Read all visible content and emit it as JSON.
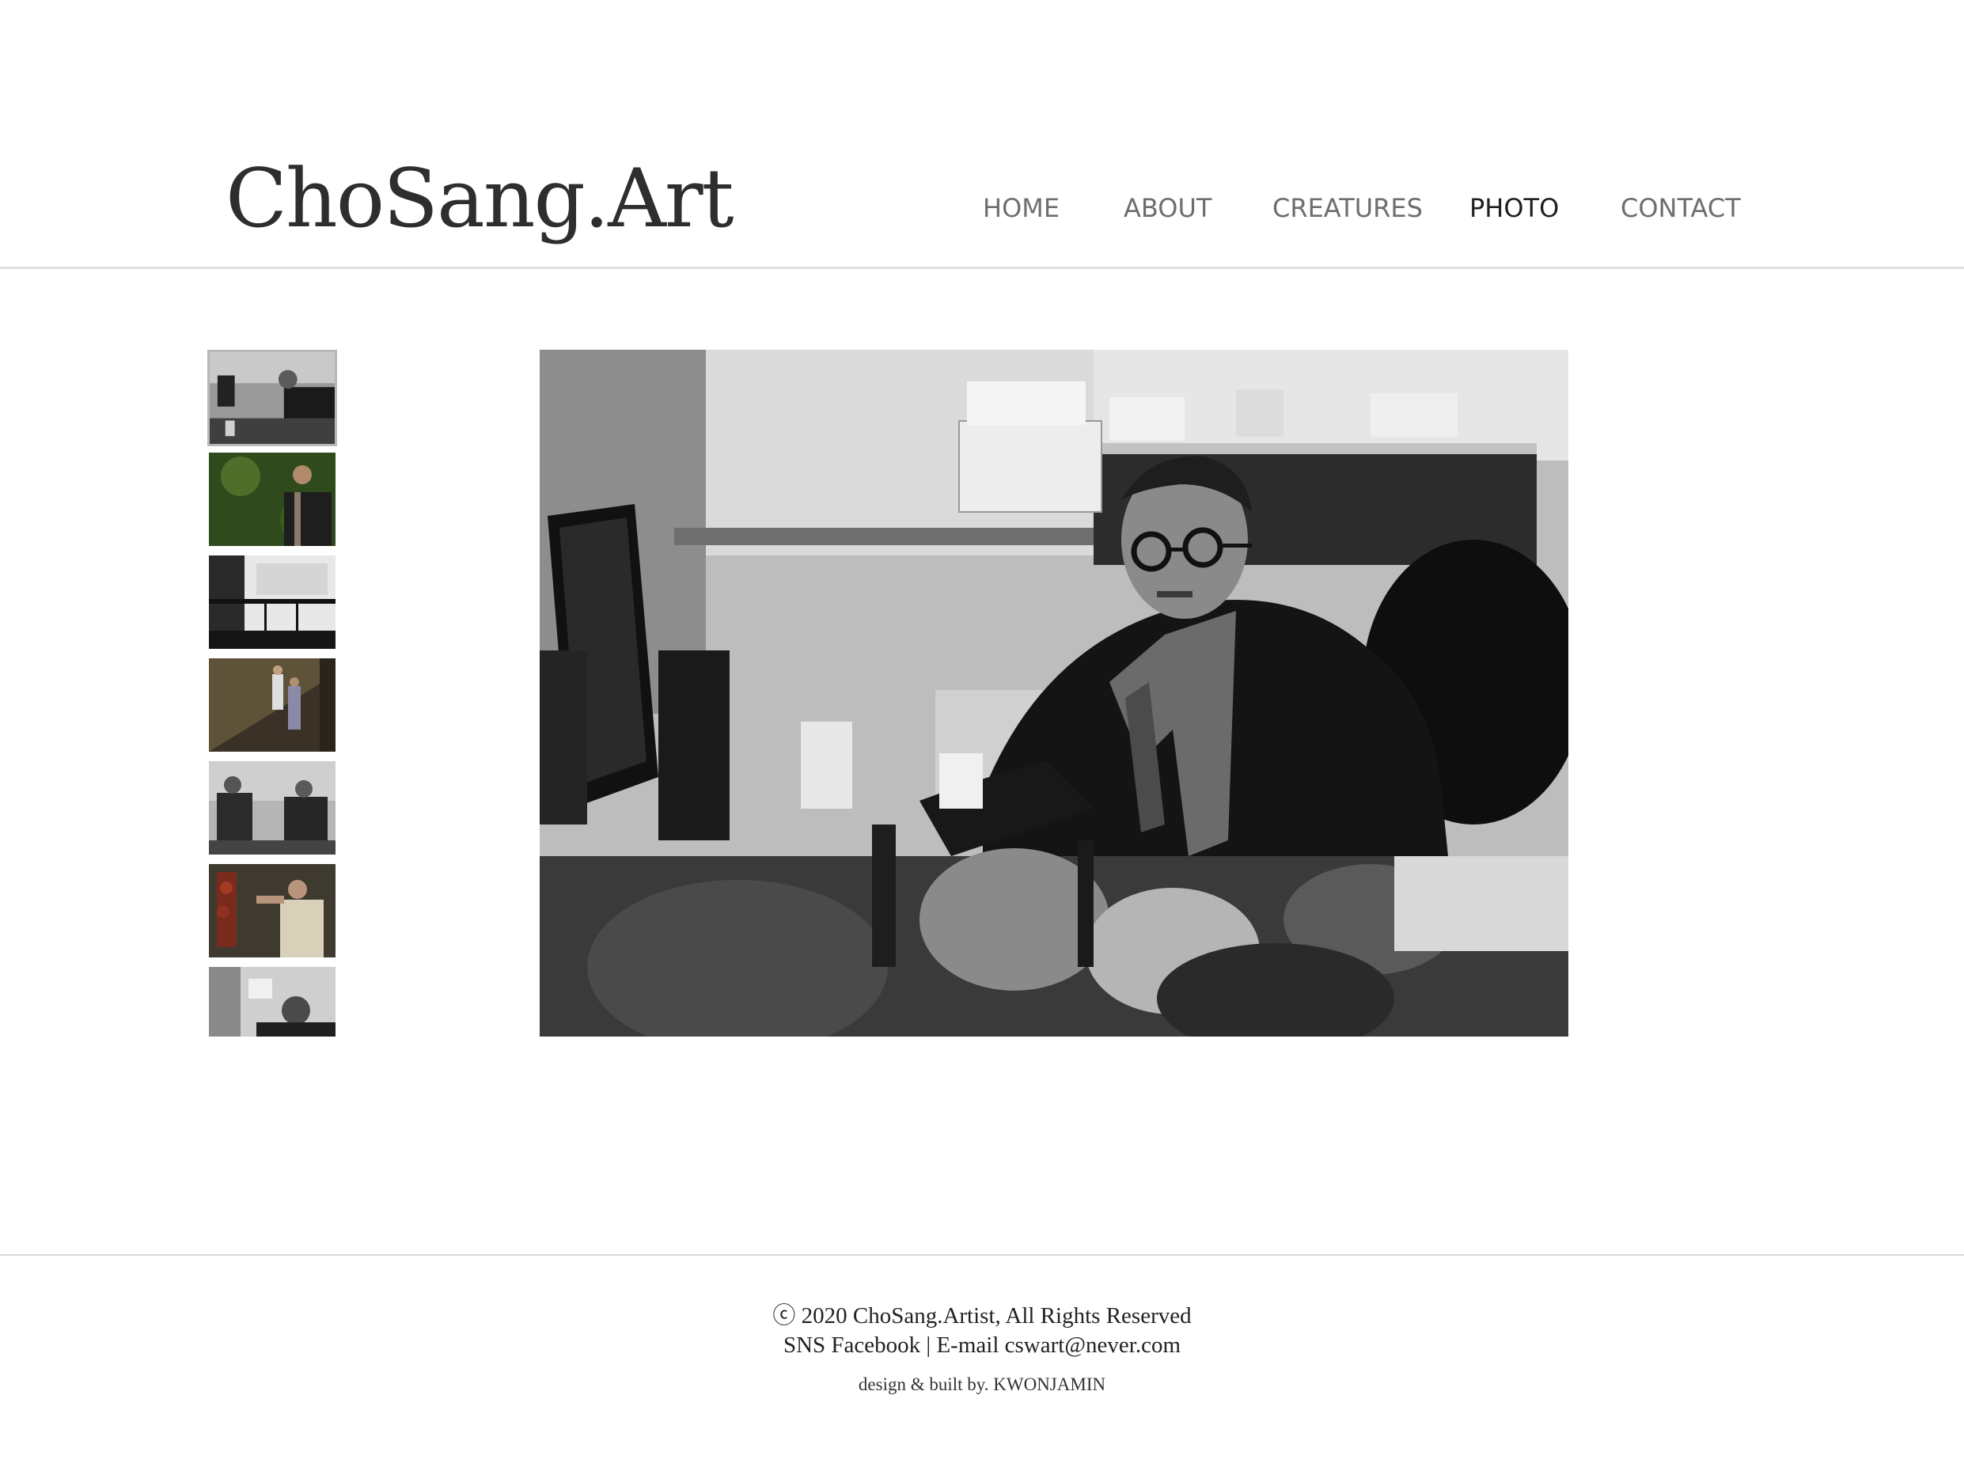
{
  "site": {
    "logo": "ChoSang.Art"
  },
  "nav": {
    "items": [
      {
        "label": "HOME"
      },
      {
        "label": "ABOUT"
      },
      {
        "label": "CREATURES"
      },
      {
        "label": "PHOTO"
      },
      {
        "label": "CONTACT"
      }
    ],
    "active": "PHOTO"
  },
  "gallery": {
    "thumbnails_count": 7,
    "selected_index": 0
  },
  "footer": {
    "copyright": "ⓒ 2020 ChoSang.Artist, All Rights Reserved",
    "links": "SNS Facebook | E-mail cswart@never.com",
    "credit": "design & built by. KWONJAMIN"
  },
  "colors": {
    "text_dark": "#2e2e2e",
    "nav_inactive": "#6e6e6e",
    "nav_active": "#1f1f1f",
    "rule": "#e0e0e0"
  }
}
